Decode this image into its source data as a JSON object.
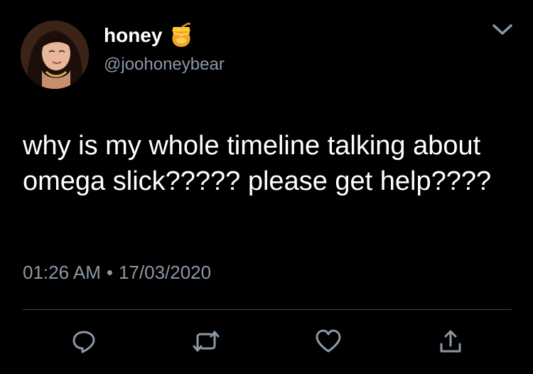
{
  "tweet": {
    "author": {
      "display_name": "honey",
      "handle": "@joohoneybear",
      "name_emoji": "honey-pot-icon"
    },
    "text": "why is my whole timeline talking about omega slick????? please get help????",
    "time": "01:26 AM",
    "separator": "•",
    "date": "17/03/2020",
    "menu_icon": "chevron-down-icon"
  },
  "actions": [
    {
      "name": "reply",
      "icon": "reply-icon"
    },
    {
      "name": "retweet",
      "icon": "retweet-icon"
    },
    {
      "name": "like",
      "icon": "heart-icon"
    },
    {
      "name": "share",
      "icon": "share-icon"
    }
  ],
  "colors": {
    "background": "#000000",
    "primary_text": "#ffffff",
    "secondary_text": "#8b98a5",
    "divider": "#38444d",
    "honey": "#f4b400"
  }
}
